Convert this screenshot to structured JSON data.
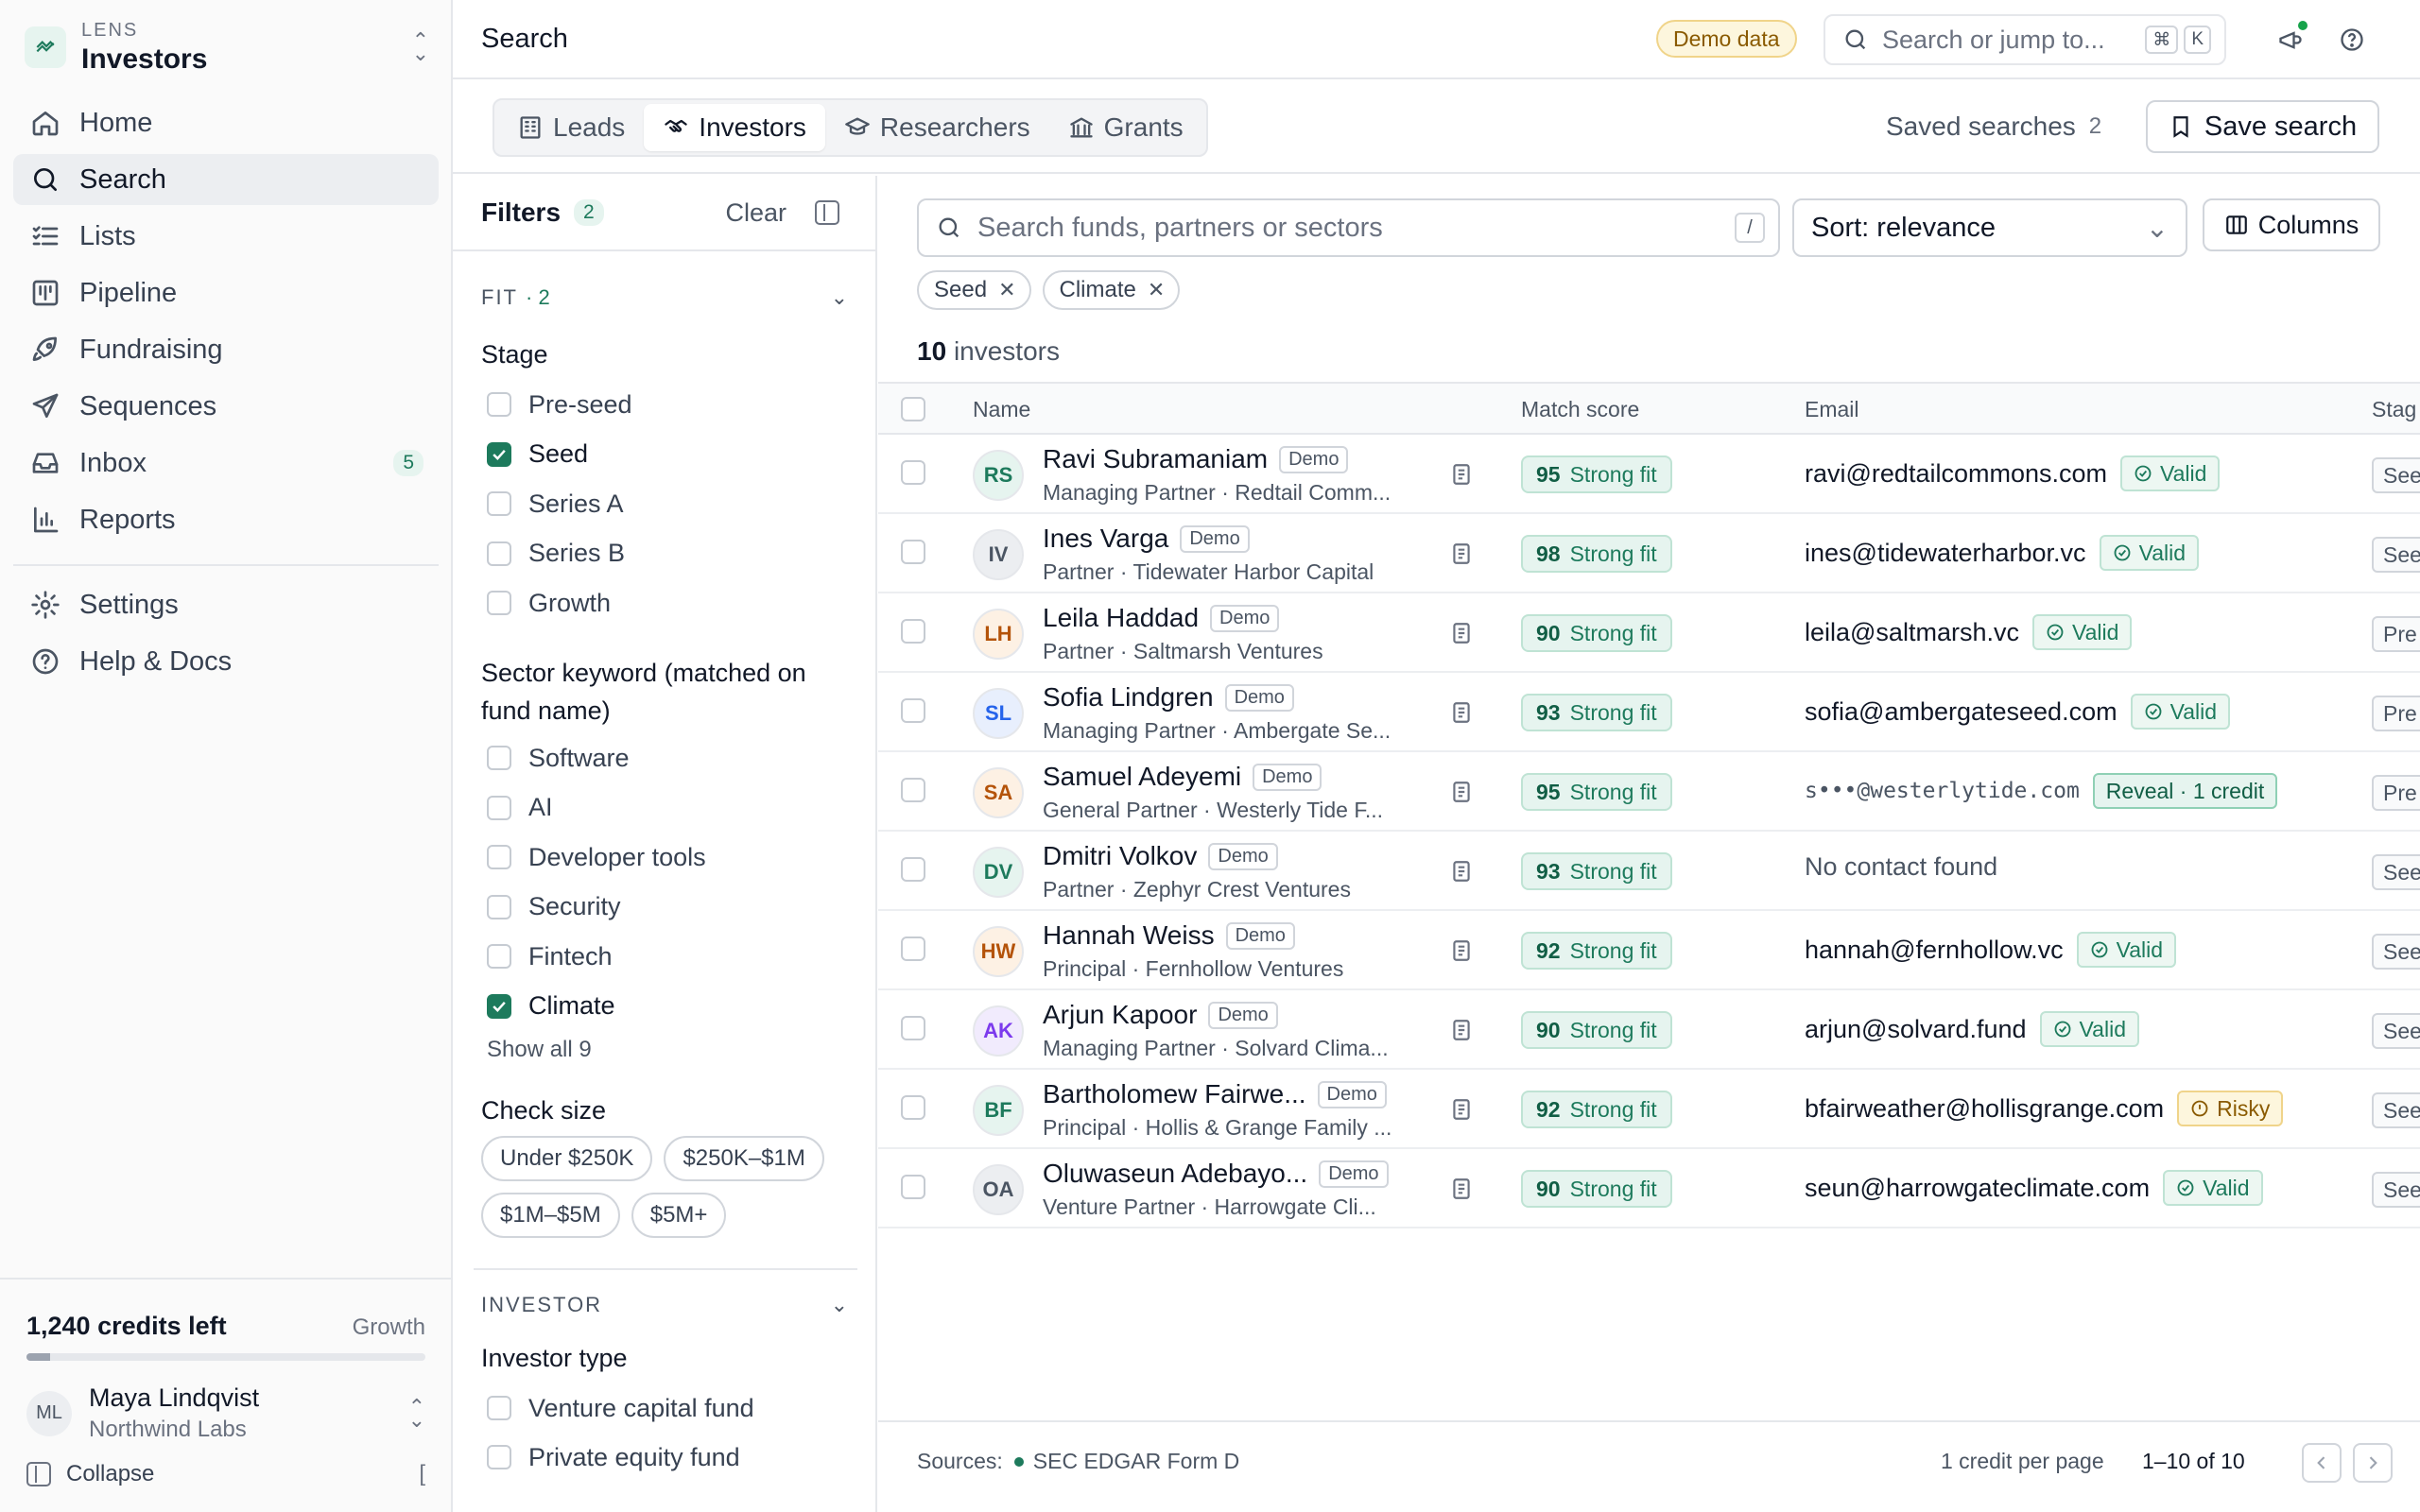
{
  "workspace": {
    "small_label": "LENS",
    "name": "Investors"
  },
  "nav": [
    {
      "label": "Home",
      "icon": "home-icon",
      "active": false
    },
    {
      "label": "Search",
      "icon": "search-icon",
      "active": true
    },
    {
      "label": "Lists",
      "icon": "list-icon",
      "active": false
    },
    {
      "label": "Pipeline",
      "icon": "kanban-icon",
      "active": false
    },
    {
      "label": "Fundraising",
      "icon": "rocket-icon",
      "active": false
    },
    {
      "label": "Sequences",
      "icon": "send-icon",
      "active": false
    },
    {
      "label": "Inbox",
      "icon": "inbox-icon",
      "active": false,
      "badge": "5"
    },
    {
      "label": "Reports",
      "icon": "bar-chart-icon",
      "active": false
    }
  ],
  "nav_secondary": [
    {
      "label": "Settings",
      "icon": "gear-icon"
    },
    {
      "label": "Help & Docs",
      "icon": "help-icon"
    }
  ],
  "credits": {
    "label": "1,240 credits left",
    "plan": "Growth",
    "used_fraction": 0.06
  },
  "user": {
    "initials": "ML",
    "name": "Maya Lindqvist",
    "org": "Northwind Labs"
  },
  "collapse": {
    "label": "Collapse",
    "shortcut": "["
  },
  "topbar": {
    "title": "Search",
    "demo_label": "Demo data",
    "search_placeholder": "Search or jump to...",
    "keys": [
      "⌘",
      "K"
    ]
  },
  "tabs": [
    {
      "label": "Leads",
      "icon": "building-icon",
      "active": false
    },
    {
      "label": "Investors",
      "icon": "handshake-icon",
      "active": true
    },
    {
      "label": "Researchers",
      "icon": "graduation-cap-icon",
      "active": false
    },
    {
      "label": "Grants",
      "icon": "landmark-icon",
      "active": false
    }
  ],
  "saved_searches": {
    "label": "Saved searches",
    "count": "2"
  },
  "save_search_label": "Save search",
  "filters": {
    "title": "Filters",
    "count": "2",
    "clear": "Clear",
    "fit_section": {
      "title": "FIT",
      "count": "· 2"
    },
    "stage": {
      "title": "Stage",
      "options": [
        {
          "label": "Pre-seed",
          "checked": false
        },
        {
          "label": "Seed",
          "checked": true
        },
        {
          "label": "Series A",
          "checked": false
        },
        {
          "label": "Series B",
          "checked": false
        },
        {
          "label": "Growth",
          "checked": false
        }
      ]
    },
    "sector": {
      "title_line1": "Sector keyword (matched on",
      "title_line2": "fund name)",
      "options": [
        {
          "label": "Software",
          "checked": false
        },
        {
          "label": "AI",
          "checked": false
        },
        {
          "label": "Developer tools",
          "checked": false
        },
        {
          "label": "Security",
          "checked": false
        },
        {
          "label": "Fintech",
          "checked": false
        },
        {
          "label": "Climate",
          "checked": true
        }
      ],
      "show_all": "Show all 9"
    },
    "check_size": {
      "title": "Check size",
      "options": [
        "Under $250K",
        "$250K–$1M",
        "$1M–$5M",
        "$5M+"
      ]
    },
    "investor_section": {
      "title": "INVESTOR"
    },
    "investor_type": {
      "title": "Investor type",
      "options": [
        {
          "label": "Venture capital fund",
          "checked": false
        },
        {
          "label": "Private equity fund",
          "checked": false
        }
      ]
    }
  },
  "main": {
    "search_placeholder": "Search funds, partners or sectors",
    "slash_key": "/",
    "sort_label": "Sort: relevance",
    "columns_label": "Columns",
    "active_tags": [
      "Seed",
      "Climate"
    ],
    "count_number": "10",
    "count_suffix": "investors",
    "headers": {
      "name": "Name",
      "score": "Match score",
      "email": "Email",
      "stage": "Stag"
    },
    "rows": [
      {
        "initials": "RS",
        "color": "#1d7a5c",
        "bg": "#e6f4ef",
        "name": "Ravi Subramaniam",
        "sub": "Managing Partner · Redtail Comm...",
        "score": "95",
        "fit": "Strong fit",
        "email": "ravi@redtailcommons.com",
        "status": "Valid",
        "status_type": "valid",
        "stage": "See"
      },
      {
        "initials": "IV",
        "color": "#4b5563",
        "bg": "#eceef1",
        "name": "Ines Varga",
        "sub": "Partner · Tidewater Harbor Capital",
        "score": "98",
        "fit": "Strong fit",
        "email": "ines@tidewaterharbor.vc",
        "status": "Valid",
        "status_type": "valid",
        "stage": "See"
      },
      {
        "initials": "LH",
        "color": "#b45309",
        "bg": "#fdf1e4",
        "name": "Leila Haddad",
        "sub": "Partner · Saltmarsh Ventures",
        "score": "90",
        "fit": "Strong fit",
        "email": "leila@saltmarsh.vc",
        "status": "Valid",
        "status_type": "valid",
        "stage": "Pre"
      },
      {
        "initials": "SL",
        "color": "#2563eb",
        "bg": "#e8effd",
        "name": "Sofia Lindgren",
        "sub": "Managing Partner · Ambergate Se...",
        "score": "93",
        "fit": "Strong fit",
        "email": "sofia@ambergateseed.com",
        "status": "Valid",
        "status_type": "valid",
        "stage": "Pre"
      },
      {
        "initials": "SA",
        "color": "#b45309",
        "bg": "#fdf1e4",
        "name": "Samuel Adeyemi",
        "sub": "General Partner · Westerly Tide F...",
        "score": "95",
        "fit": "Strong fit",
        "email": "s•••@westerlytide.com",
        "status": "Reveal · 1 credit",
        "status_type": "reveal",
        "stage": "Pre"
      },
      {
        "initials": "DV",
        "color": "#1d7a5c",
        "bg": "#e6f4ef",
        "name": "Dmitri Volkov",
        "sub": "Partner · Zephyr Crest Ventures",
        "score": "93",
        "fit": "Strong fit",
        "email": "No contact found",
        "status": "",
        "status_type": "none",
        "stage": "See"
      },
      {
        "initials": "HW",
        "color": "#b45309",
        "bg": "#fdf1e4",
        "name": "Hannah Weiss",
        "sub": "Principal · Fernhollow Ventures",
        "score": "92",
        "fit": "Strong fit",
        "email": "hannah@fernhollow.vc",
        "status": "Valid",
        "status_type": "valid",
        "stage": "See"
      },
      {
        "initials": "AK",
        "color": "#7c3aed",
        "bg": "#f1ebfd",
        "name": "Arjun Kapoor",
        "sub": "Managing Partner · Solvard Clima...",
        "score": "90",
        "fit": "Strong fit",
        "email": "arjun@solvard.fund",
        "status": "Valid",
        "status_type": "valid",
        "stage": "See"
      },
      {
        "initials": "BF",
        "color": "#1d7a5c",
        "bg": "#e6f4ef",
        "name": "Bartholomew Fairwe...",
        "sub": "Principal · Hollis & Grange Family ...",
        "score": "92",
        "fit": "Strong fit",
        "email": "bfairweather@hollisgrange.com",
        "status": "Risky",
        "status_type": "risky",
        "stage": "See"
      },
      {
        "initials": "OA",
        "color": "#4b5563",
        "bg": "#eceef1",
        "name": "Oluwaseun Adebayo...",
        "sub": "Venture Partner · Harrowgate Cli...",
        "score": "90",
        "fit": "Strong fit",
        "email": "seun@harrowgateclimate.com",
        "status": "Valid",
        "status_type": "valid",
        "stage": "See"
      }
    ],
    "demo_tag": "Demo",
    "footer": {
      "sources_label": "Sources:",
      "source": "SEC EDGAR Form D",
      "per_page": "1 credit per page",
      "range": "1–10 of 10"
    }
  }
}
